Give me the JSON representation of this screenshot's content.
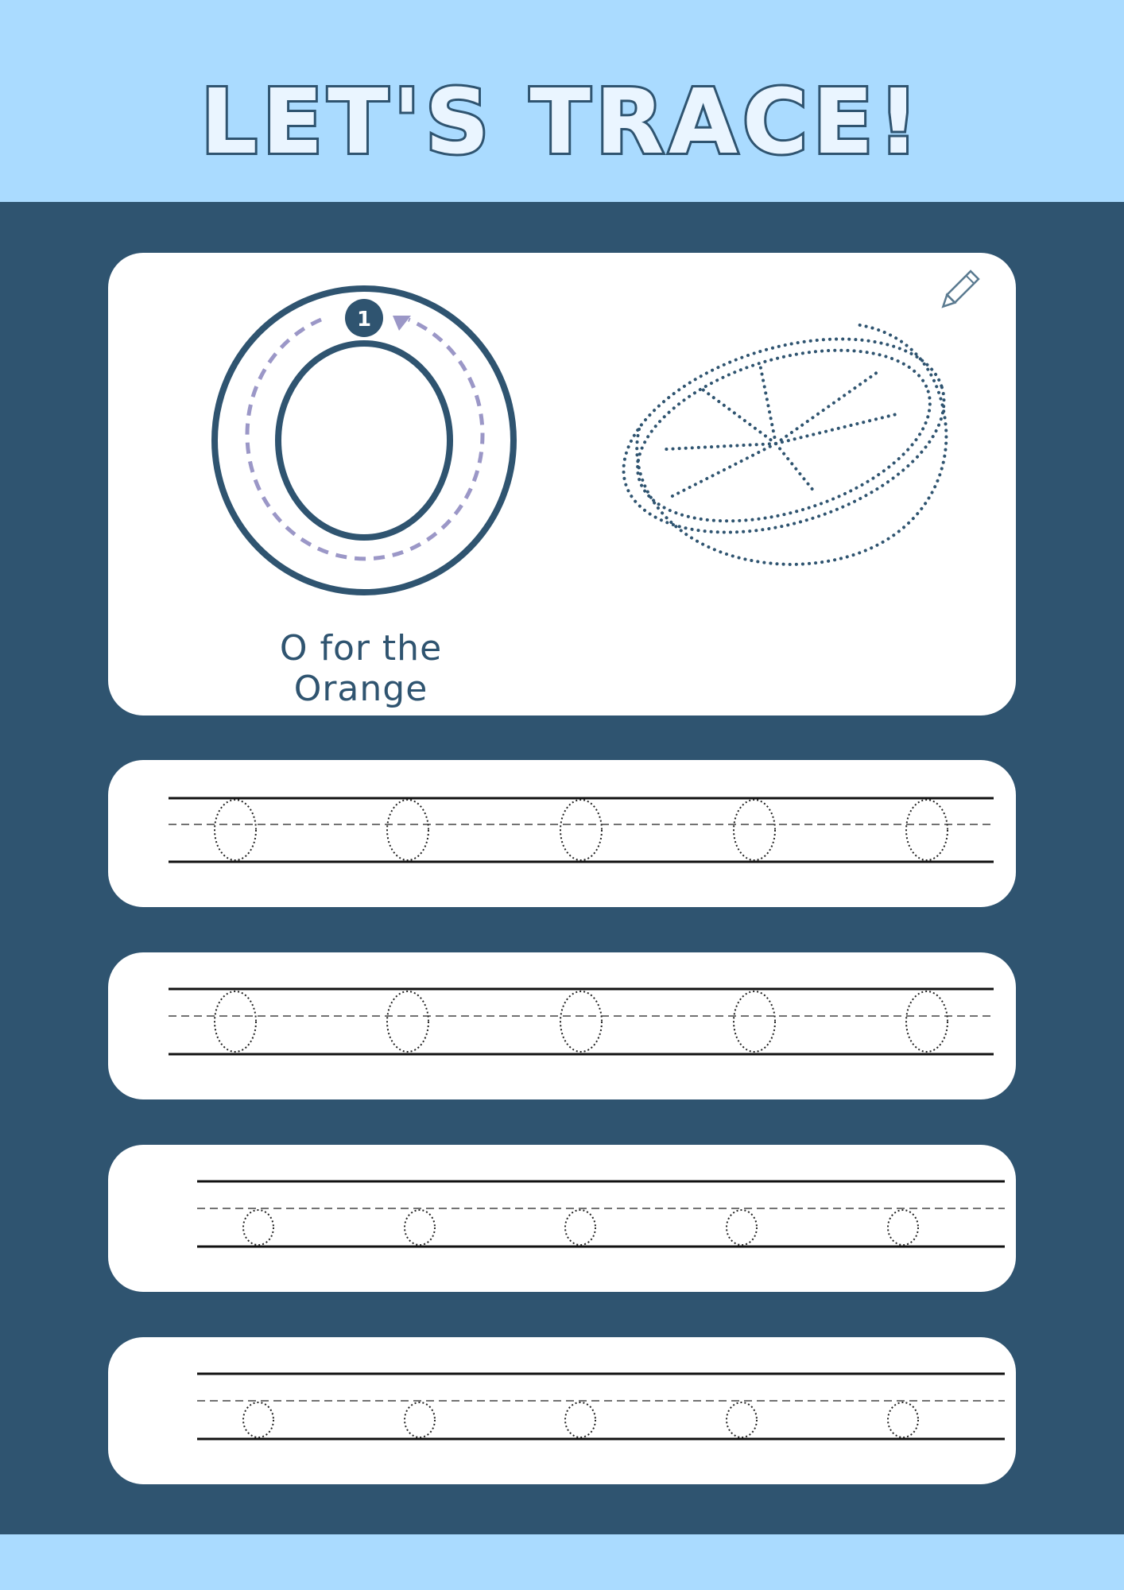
{
  "header": {
    "title": "LET'S TRACE!"
  },
  "letter_card": {
    "letter": "O",
    "stroke_number": "1",
    "caption": "O for the Orange",
    "illustration": "orange-half-dotted",
    "pencil": "pencil-icon"
  },
  "practice_rows": [
    {
      "case": "uppercase",
      "letter": "O",
      "count": 5
    },
    {
      "case": "uppercase",
      "letter": "O",
      "count": 5
    },
    {
      "case": "lowercase",
      "letter": "o",
      "count": 5
    },
    {
      "case": "lowercase",
      "letter": "o",
      "count": 5
    }
  ],
  "colors": {
    "light_blue": "#aadbff",
    "navy": "#2f5470",
    "guide_purple": "#9b97c7",
    "white": "#ffffff"
  }
}
